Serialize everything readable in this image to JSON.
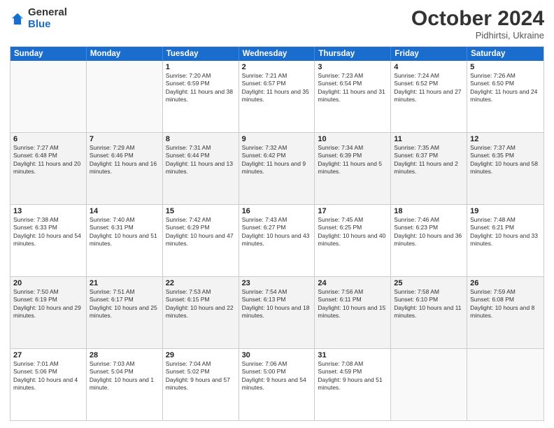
{
  "header": {
    "logo_general": "General",
    "logo_blue": "Blue",
    "title": "October 2024",
    "location": "Pidhirtsi, Ukraine"
  },
  "days_of_week": [
    "Sunday",
    "Monday",
    "Tuesday",
    "Wednesday",
    "Thursday",
    "Friday",
    "Saturday"
  ],
  "weeks": [
    [
      {
        "day": "",
        "text": "",
        "empty": true
      },
      {
        "day": "",
        "text": "",
        "empty": true
      },
      {
        "day": "1",
        "text": "Sunrise: 7:20 AM\nSunset: 6:59 PM\nDaylight: 11 hours and 38 minutes."
      },
      {
        "day": "2",
        "text": "Sunrise: 7:21 AM\nSunset: 6:57 PM\nDaylight: 11 hours and 35 minutes."
      },
      {
        "day": "3",
        "text": "Sunrise: 7:23 AM\nSunset: 6:54 PM\nDaylight: 11 hours and 31 minutes."
      },
      {
        "day": "4",
        "text": "Sunrise: 7:24 AM\nSunset: 6:52 PM\nDaylight: 11 hours and 27 minutes."
      },
      {
        "day": "5",
        "text": "Sunrise: 7:26 AM\nSunset: 6:50 PM\nDaylight: 11 hours and 24 minutes."
      }
    ],
    [
      {
        "day": "6",
        "text": "Sunrise: 7:27 AM\nSunset: 6:48 PM\nDaylight: 11 hours and 20 minutes."
      },
      {
        "day": "7",
        "text": "Sunrise: 7:29 AM\nSunset: 6:46 PM\nDaylight: 11 hours and 16 minutes."
      },
      {
        "day": "8",
        "text": "Sunrise: 7:31 AM\nSunset: 6:44 PM\nDaylight: 11 hours and 13 minutes."
      },
      {
        "day": "9",
        "text": "Sunrise: 7:32 AM\nSunset: 6:42 PM\nDaylight: 11 hours and 9 minutes."
      },
      {
        "day": "10",
        "text": "Sunrise: 7:34 AM\nSunset: 6:39 PM\nDaylight: 11 hours and 5 minutes."
      },
      {
        "day": "11",
        "text": "Sunrise: 7:35 AM\nSunset: 6:37 PM\nDaylight: 11 hours and 2 minutes."
      },
      {
        "day": "12",
        "text": "Sunrise: 7:37 AM\nSunset: 6:35 PM\nDaylight: 10 hours and 58 minutes."
      }
    ],
    [
      {
        "day": "13",
        "text": "Sunrise: 7:38 AM\nSunset: 6:33 PM\nDaylight: 10 hours and 54 minutes."
      },
      {
        "day": "14",
        "text": "Sunrise: 7:40 AM\nSunset: 6:31 PM\nDaylight: 10 hours and 51 minutes."
      },
      {
        "day": "15",
        "text": "Sunrise: 7:42 AM\nSunset: 6:29 PM\nDaylight: 10 hours and 47 minutes."
      },
      {
        "day": "16",
        "text": "Sunrise: 7:43 AM\nSunset: 6:27 PM\nDaylight: 10 hours and 43 minutes."
      },
      {
        "day": "17",
        "text": "Sunrise: 7:45 AM\nSunset: 6:25 PM\nDaylight: 10 hours and 40 minutes."
      },
      {
        "day": "18",
        "text": "Sunrise: 7:46 AM\nSunset: 6:23 PM\nDaylight: 10 hours and 36 minutes."
      },
      {
        "day": "19",
        "text": "Sunrise: 7:48 AM\nSunset: 6:21 PM\nDaylight: 10 hours and 33 minutes."
      }
    ],
    [
      {
        "day": "20",
        "text": "Sunrise: 7:50 AM\nSunset: 6:19 PM\nDaylight: 10 hours and 29 minutes."
      },
      {
        "day": "21",
        "text": "Sunrise: 7:51 AM\nSunset: 6:17 PM\nDaylight: 10 hours and 25 minutes."
      },
      {
        "day": "22",
        "text": "Sunrise: 7:53 AM\nSunset: 6:15 PM\nDaylight: 10 hours and 22 minutes."
      },
      {
        "day": "23",
        "text": "Sunrise: 7:54 AM\nSunset: 6:13 PM\nDaylight: 10 hours and 18 minutes."
      },
      {
        "day": "24",
        "text": "Sunrise: 7:56 AM\nSunset: 6:11 PM\nDaylight: 10 hours and 15 minutes."
      },
      {
        "day": "25",
        "text": "Sunrise: 7:58 AM\nSunset: 6:10 PM\nDaylight: 10 hours and 11 minutes."
      },
      {
        "day": "26",
        "text": "Sunrise: 7:59 AM\nSunset: 6:08 PM\nDaylight: 10 hours and 8 minutes."
      }
    ],
    [
      {
        "day": "27",
        "text": "Sunrise: 7:01 AM\nSunset: 5:06 PM\nDaylight: 10 hours and 4 minutes."
      },
      {
        "day": "28",
        "text": "Sunrise: 7:03 AM\nSunset: 5:04 PM\nDaylight: 10 hours and 1 minute."
      },
      {
        "day": "29",
        "text": "Sunrise: 7:04 AM\nSunset: 5:02 PM\nDaylight: 9 hours and 57 minutes."
      },
      {
        "day": "30",
        "text": "Sunrise: 7:06 AM\nSunset: 5:00 PM\nDaylight: 9 hours and 54 minutes."
      },
      {
        "day": "31",
        "text": "Sunrise: 7:08 AM\nSunset: 4:59 PM\nDaylight: 9 hours and 51 minutes."
      },
      {
        "day": "",
        "text": "",
        "empty": true
      },
      {
        "day": "",
        "text": "",
        "empty": true
      }
    ]
  ]
}
